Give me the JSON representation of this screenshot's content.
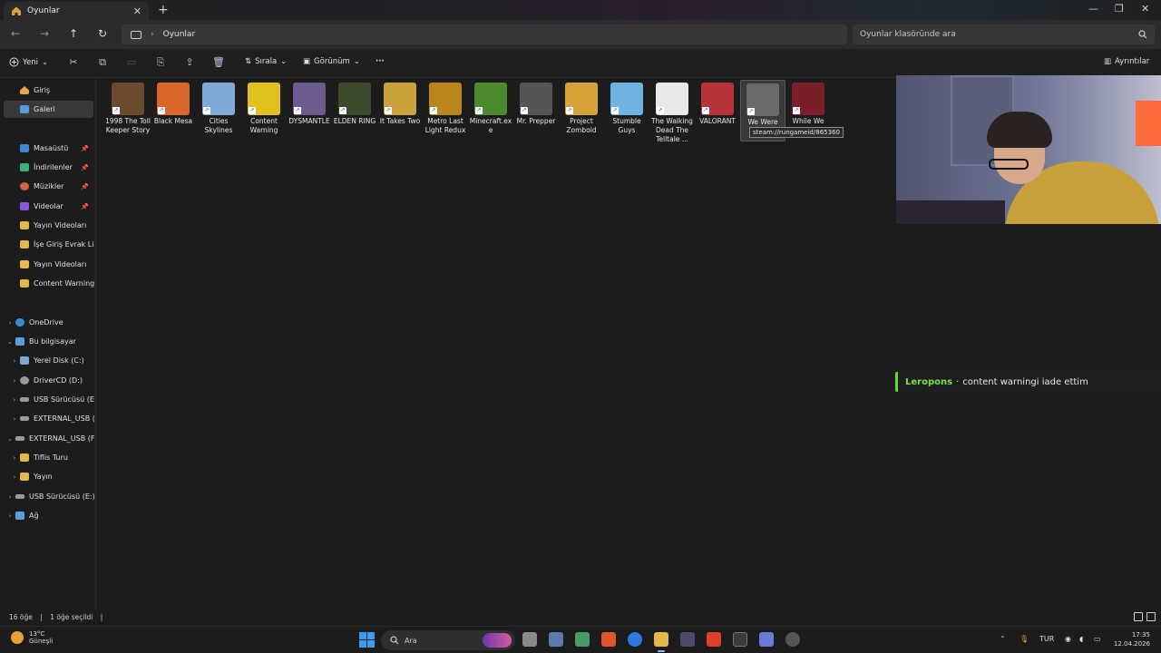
{
  "window": {
    "tab_title": "Oyunlar",
    "tab_close": "✕",
    "new_tab": "+",
    "min": "—",
    "max": "❐",
    "close": "✕"
  },
  "nav": {
    "back": "←",
    "forward": "→",
    "up": "↑",
    "refresh": "↻",
    "breadcrumb_sep": "›",
    "location": "Oyunlar",
    "search_placeholder": "Oyunlar klasöründe ara"
  },
  "commands": {
    "new": "Yeni",
    "sort": "Sırala",
    "view": "Görünüm",
    "more": "···",
    "details": "Ayrıntılar"
  },
  "sidebar": {
    "quick": [
      {
        "label": "Giriş"
      },
      {
        "label": "Galeri"
      }
    ],
    "pinned": [
      {
        "label": "Masaüstü"
      },
      {
        "label": "İndirilenler"
      },
      {
        "label": "Müzikler"
      },
      {
        "label": "Videolar"
      },
      {
        "label": "Yayın Videoları"
      },
      {
        "label": "İşe Giriş Evrak Listesi"
      },
      {
        "label": "Yayın Videoları"
      },
      {
        "label": "Content Warning"
      }
    ],
    "tree": [
      {
        "label": "OneDrive"
      },
      {
        "label": "Bu bilgisayar"
      },
      {
        "label": "Yerel Disk (C:)"
      },
      {
        "label": "DriverCD (D:)"
      },
      {
        "label": "USB Sürücüsü (E:)"
      },
      {
        "label": "EXTERNAL_USB (F:)"
      },
      {
        "label": "EXTERNAL_USB (F:)"
      },
      {
        "label": "Tiflis Turu"
      },
      {
        "label": "Yayın"
      },
      {
        "label": "USB Sürücüsü (E:)"
      },
      {
        "label": "Ağ"
      }
    ]
  },
  "files": [
    {
      "name": "1998 The Toll Keeper Story",
      "color": "#6b4a2e"
    },
    {
      "name": "Black Mesa",
      "color": "#d9662a"
    },
    {
      "name": "Cities Skylines",
      "color": "#7fa9d6"
    },
    {
      "name": "Content Warning",
      "color": "#e0c21c"
    },
    {
      "name": "DYSMANTLE",
      "color": "#6b5b8e"
    },
    {
      "name": "ELDEN RING",
      "color": "#3e4a2e"
    },
    {
      "name": "It Takes Two",
      "color": "#c9a23a"
    },
    {
      "name": "Metro Last Light Redux",
      "color": "#b8861a"
    },
    {
      "name": "Minecraft.exe",
      "color": "#4c8a2e"
    },
    {
      "name": "Mr. Prepper",
      "color": "#555555"
    },
    {
      "name": "Project Zomboid",
      "color": "#d8a23a"
    },
    {
      "name": "Stumble Guys",
      "color": "#6fb3e0"
    },
    {
      "name": "The Walking Dead The Telltale ...",
      "color": "#e8e8e8"
    },
    {
      "name": "VALORANT",
      "color": "#b8323a"
    },
    {
      "name": "We Were Here Together",
      "color": "#6a6a6a"
    },
    {
      "name": "While We Wait Here",
      "color": "#7a1f2a"
    }
  ],
  "tooltip": "steam://rungameid/865360",
  "chat": {
    "user": "Leropons",
    "sep": "·",
    "message": "content warningi iade ettim"
  },
  "status": {
    "count": "16 öğe",
    "selected": "1 öğe seçildi"
  },
  "taskbar": {
    "temp": "13°C",
    "weather": "Güneşli",
    "search": "Ara",
    "lang": "TUR",
    "time": "17:35",
    "date": "12.04.2026"
  }
}
